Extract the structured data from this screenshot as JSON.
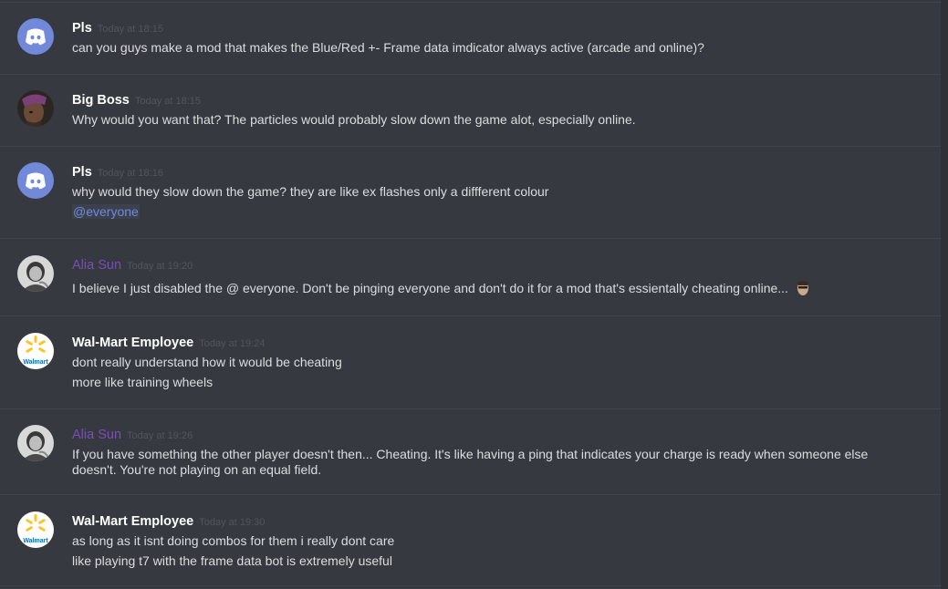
{
  "messages": [
    {
      "author": "Pls",
      "timestamp": "Today at 18:15",
      "lines": [
        "can you guys make a mod that makes the Blue/Red +- Frame data imdicator always active (arcade and online)?"
      ]
    },
    {
      "author": "Big Boss",
      "timestamp": "Today at 18:15",
      "lines": [
        "Why would you want that? The particles would probably slow down the game alot, especially online."
      ]
    },
    {
      "author": "Pls",
      "timestamp": "Today at 18:16",
      "lines": [
        "why would they slow down the game? they are like ex flashes only a diffferent colour"
      ],
      "mention": "@everyone"
    },
    {
      "author": "Alia Sun",
      "timestamp": "Today at 19:20",
      "lines": [
        "I believe I just disabled the @ everyone. Don't be pinging everyone and don't do it for a mod that's essientally cheating online..."
      ],
      "emoji": "face-emoji"
    },
    {
      "author": "Wal-Mart Employee",
      "timestamp": "Today at 19:24",
      "lines": [
        "dont really understand how it would be cheating",
        "more like training wheels"
      ]
    },
    {
      "author": "Alia Sun",
      "timestamp": "Today at 19:26",
      "lines": [
        "If you have something the other player doesn't then... Cheating. It's like having a ping that indicates your charge is ready when someone else doesn't. You're not playing on an equal field."
      ]
    },
    {
      "author": "Wal-Mart Employee",
      "timestamp": "Today at 19:30",
      "lines": [
        "as long as it isnt doing combos for them i really dont care",
        "like playing t7 with the frame data bot is extremely useful"
      ]
    }
  ],
  "avatars": {
    "discord_default": "discord-logo-icon",
    "big_boss": "character-portrait",
    "alia_sun": "grayscale-photo",
    "walmart": "walmart-spark-logo",
    "walmart_text": "Walmart"
  },
  "colors": {
    "background": "#36393f",
    "username_default": "#ffffff",
    "username_role": "#7a4dba",
    "mention": "#7289da",
    "discord_blurple": "#7289da"
  }
}
